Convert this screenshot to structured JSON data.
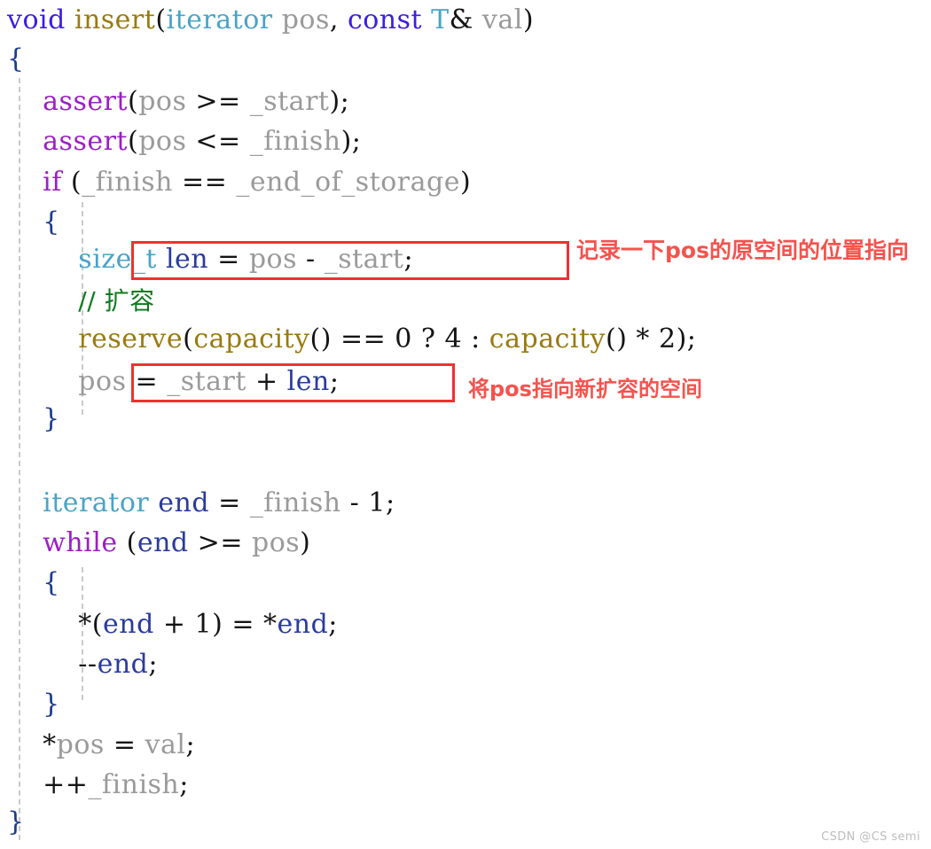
{
  "document": {
    "title": "void insert(iterator pos, const T& val)",
    "language": "C++",
    "watermark": "CSDN @CS semi",
    "background": "#ffffff"
  },
  "colors": {
    "keyword": "#3b1fe0",
    "control_keyword": "#9b1fc4",
    "type": "#4aa3c7",
    "function": "#9a7a10",
    "member_variable": "#9a9a9a",
    "local_variable": "#2a3b9e",
    "punctuation": "#141414",
    "comment": "#0f7a1c",
    "brace": "#1b3a8f",
    "highlight_box": "#f03030",
    "annotation": "#f4534e",
    "indent_guide": "#c9c9c9",
    "watermark": "#bdbdbd"
  },
  "code": {
    "lines": [
      {
        "n": 1,
        "indent": 0,
        "text": "void insert(iterator pos, const T& val)"
      },
      {
        "n": 2,
        "indent": 0,
        "text": "{"
      },
      {
        "n": 3,
        "indent": 1,
        "text": "assert(pos >= _start);"
      },
      {
        "n": 4,
        "indent": 1,
        "text": "assert(pos <= _finish);"
      },
      {
        "n": 5,
        "indent": 1,
        "text": "if (_finish == _end_of_storage)"
      },
      {
        "n": 6,
        "indent": 1,
        "text": "{"
      },
      {
        "n": 7,
        "indent": 2,
        "text": "size_t len = pos - _start;"
      },
      {
        "n": 8,
        "indent": 2,
        "text": "// 扩容"
      },
      {
        "n": 9,
        "indent": 2,
        "text": "reserve(capacity() == 0 ? 4 : capacity() * 2);"
      },
      {
        "n": 10,
        "indent": 2,
        "text": "pos = _start + len;"
      },
      {
        "n": 11,
        "indent": 1,
        "text": "}"
      },
      {
        "n": 12,
        "indent": 1,
        "text": ""
      },
      {
        "n": 13,
        "indent": 1,
        "text": "iterator end = _finish - 1;"
      },
      {
        "n": 14,
        "indent": 1,
        "text": "while (end >= pos)"
      },
      {
        "n": 15,
        "indent": 1,
        "text": "{"
      },
      {
        "n": 16,
        "indent": 2,
        "text": "*(end + 1) = *end;"
      },
      {
        "n": 17,
        "indent": 2,
        "text": "--end;"
      },
      {
        "n": 18,
        "indent": 1,
        "text": "}"
      },
      {
        "n": 19,
        "indent": 1,
        "text": "*pos = val;"
      },
      {
        "n": 20,
        "indent": 1,
        "text": "++_finish;"
      },
      {
        "n": 21,
        "indent": 0,
        "text": "}"
      }
    ]
  },
  "highlights": [
    {
      "id": 1,
      "target_line": 7,
      "label": "size_t len = pos - _start;"
    },
    {
      "id": 2,
      "target_line": 10,
      "label": "pos = _start + len;"
    }
  ],
  "annotations": {
    "annotation_1": "记录一下pos的原空间的位置指向",
    "annotation_2": "将pos指向新扩容的空间"
  }
}
